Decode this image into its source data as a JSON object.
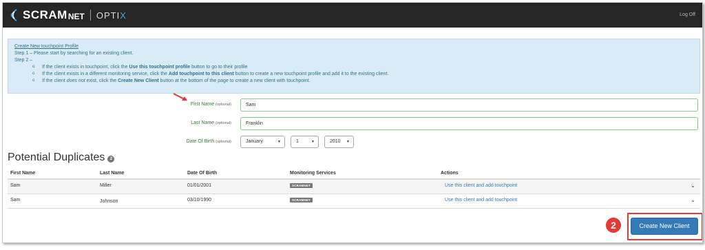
{
  "brand": {
    "name": "SCRAM",
    "name_suffix": "NET",
    "product": "OPTI",
    "product_x": "X"
  },
  "nav": {
    "logoff_label": "Log Off"
  },
  "info": {
    "title": "Create New touchpoint Profile",
    "step1": "Step 1 – Please start by searching for an existing client.",
    "step2": "Step 2 –",
    "b1_pre": "If the client exists in touchpoint, click the ",
    "b1_bold": "Use this touchpoint profile",
    "b1_post": " button to go to their profile",
    "b2_pre": "If the client exists in a different monitoring service, click the ",
    "b2_bold": "Add touchpoint to this client",
    "b2_post": " button to create a new touchpoint profile and add it to the existing client.",
    "b3_pre": "If the client ",
    "b3_em": "does not",
    "b3_mid": " exist, click the ",
    "b3_bold": "Create New Client",
    "b3_post": " button at the bottom of the page to create a new client with touchpoint."
  },
  "form": {
    "first_name_label": "First Name",
    "first_name_value": "Sam",
    "last_name_label": "Last Name",
    "last_name_value": "Franklin",
    "dob_label": "Date Of Birth",
    "optional": "(optional)",
    "dob_month": "January",
    "dob_day": "1",
    "dob_year": "2010"
  },
  "duplicates": {
    "title": "Potential Duplicates",
    "count": "2",
    "headers": [
      "First Name",
      "Last Name",
      "Date Of Birth",
      "Monitoring Services",
      "Actions"
    ],
    "rows": [
      {
        "first": "Sam",
        "last": "Miller",
        "dob": "01/01/2001",
        "service": "SCRAMNET",
        "action": "Use this client and add touchpoint"
      },
      {
        "first": "Sam",
        "last": "Johnson",
        "dob": "03/10/1990",
        "service": "SCRAMNET",
        "action": "Use this client and add touchpoint"
      }
    ]
  },
  "actions": {
    "create_label": "Create New Client"
  },
  "annotation": {
    "marker": "2"
  },
  "colors": {
    "navbar": "#262626",
    "info_bg": "#d9ecf5",
    "primary": "#337ab7",
    "highlight": "#e53935",
    "success_border": "#8fc08f"
  }
}
